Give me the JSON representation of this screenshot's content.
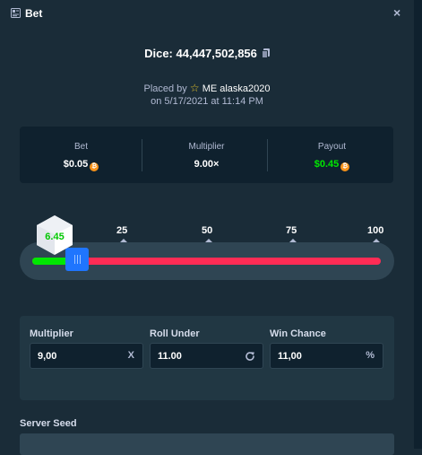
{
  "header": {
    "title": "Bet",
    "close": "×"
  },
  "bet": {
    "game": "Dice:",
    "bet_id": "44,447,502,856",
    "placed_by_prefix": "Placed by",
    "user": "ME alaska2020",
    "date": "on 5/17/2021 at 11:14 PM"
  },
  "stats": {
    "bet_label": "Bet",
    "bet_value": "$0.05",
    "multiplier_label": "Multiplier",
    "multiplier_value": "9.00×",
    "payout_label": "Payout",
    "payout_value": "$0.45",
    "currency_icon": "bitcoin-icon"
  },
  "slider": {
    "ticks": [
      "25",
      "50",
      "75",
      "100"
    ],
    "result": "6.45",
    "roll_under_fraction": 0.11,
    "colors": {
      "win": "#00e701",
      "lose": "#ff2c55",
      "handle": "#1f75fe"
    }
  },
  "fields": {
    "multiplier_label": "Multiplier",
    "multiplier_value": "9,00",
    "multiplier_suffix": "X",
    "roll_under_label": "Roll Under",
    "roll_under_value": "11.00",
    "win_chance_label": "Win Chance",
    "win_chance_value": "11,00",
    "win_chance_suffix": "%"
  },
  "server_seed": {
    "label": "Server Seed"
  }
}
